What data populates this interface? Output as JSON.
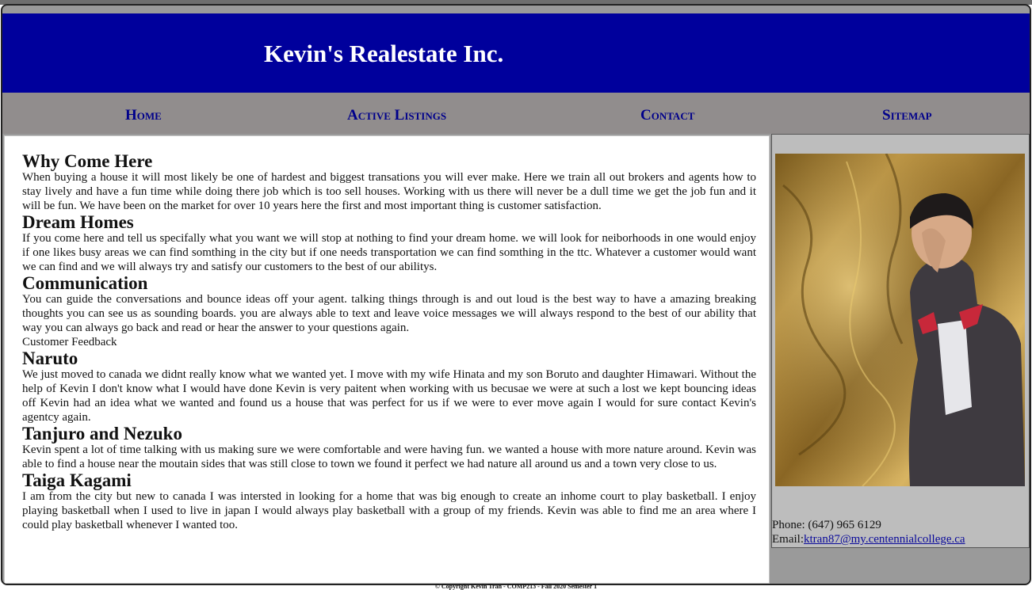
{
  "header": {
    "title": "Kevin's Realestate Inc."
  },
  "nav": {
    "items": [
      {
        "label": "Home"
      },
      {
        "label": "Active Listings"
      },
      {
        "label": "Contact"
      },
      {
        "label": "Sitemap"
      }
    ]
  },
  "main": {
    "sections": [
      {
        "heading": "Why Come Here",
        "text": "When buying a house it will most likely be one of hardest and biggest transations you will ever make. Here we train all out brokers and agents how to stay lively and have a fun time while doing there job which is too sell houses. Working with us there will never be a dull time we get the job fun and it will be fun. We have been on the market for over 10 years here the first and most important thing is customer satisfaction."
      },
      {
        "heading": "Dream Homes",
        "text": "If you come here and tell us specifally what you want we will stop at nothing to find your dream home. we will look for neiborhoods in one would enjoy if one likes busy areas we can find somthing in the city but if one needs transportation we can find somthing in the ttc. Whatever a customer would want we can find and we will always try and satisfy our customers to the best of our abilitys."
      },
      {
        "heading": "Communication",
        "text": "You can guide the conversations and bounce ideas off your agent. talking things through is and out loud is the best way to have a amazing breaking thoughts you can see us as sounding boards. you are always able to text and leave voice messages we will always respond to the best of our ability that way you can always go back and read or hear the answer to your questions again."
      }
    ],
    "feedback_label": "Customer Feedback",
    "feedback": [
      {
        "heading": "Naruto",
        "text": "We just moved to canada we didnt really know what we wanted yet. I move with my wife Hinata and my son Boruto and daughter Himawari. Without the help of Kevin I don't know what I would have done Kevin is very paitent when working with us becusae we were at such a lost we kept bouncing ideas off Kevin had an idea what we wanted and found us a house that was perfect for us if we were to ever move again I would for sure contact Kevin's agentcy again."
      },
      {
        "heading": "Tanjuro and Nezuko",
        "text": "Kevin spent a lot of time talking with us making sure we were comfortable and were having fun. we wanted a house with more nature around. Kevin was able to find a house near the moutain sides that was still close to town we found it perfect we had nature all around us and a town very close to us."
      },
      {
        "heading": "Taiga Kagami",
        "text": "I am from the city but new to canada I was intersted in looking for a home that was big enough to create an inhome court to play basketball. I enjoy playing basketball when I used to live in japan I would always play basketball with a group of my friends. Kevin was able to find me an area where I could play basketball whenever I wanted too."
      }
    ]
  },
  "sidebar": {
    "phone": "Phone: (647) 965 6129",
    "email_label": "Email:",
    "email": "ktran87@my.centennialcollege.ca"
  },
  "footer": {
    "text": "© Copyright Kevin Tran - COMP213 - Fall 2020 Semester 1"
  },
  "colors": {
    "header_bg": "#00009c",
    "nav_bg": "#918d8d",
    "nav_text": "#00008b",
    "sidebar_bg": "#bdbdbd"
  }
}
